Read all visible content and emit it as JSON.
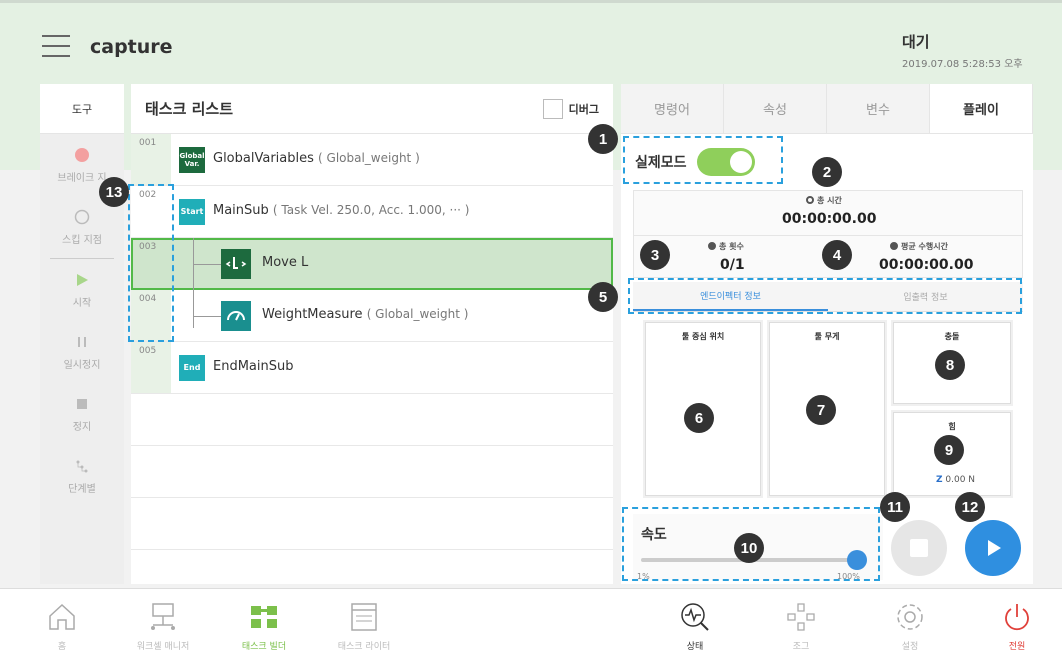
{
  "header": {
    "title": "capture",
    "status": "대기",
    "datetime": "2019.07.08 5:28:53 오후"
  },
  "tools": {
    "title": "도구",
    "items": [
      {
        "label": "브레이크 지",
        "icon": "breakpoint-icon"
      },
      {
        "label": "스킵 지점",
        "icon": "skip-point-icon"
      },
      {
        "label": "시작",
        "icon": "start-icon"
      },
      {
        "label": "일시정지",
        "icon": "pause-icon"
      },
      {
        "label": "정지",
        "icon": "stop-icon"
      },
      {
        "label": "단계별",
        "icon": "step-icon"
      }
    ]
  },
  "tasklist": {
    "title": "태스크 리스트",
    "debug_label": "디버그",
    "rows": [
      {
        "num": "001",
        "badge": "Global Var.",
        "name": "GlobalVariables",
        "param": "( Global_weight )"
      },
      {
        "num": "002",
        "badge": "Start",
        "name": "MainSub",
        "param": "( Task Vel. 250.0, Acc. 1.000, ··· )"
      },
      {
        "num": "003",
        "badge": "",
        "name": "Move L",
        "param": ""
      },
      {
        "num": "004",
        "badge": "",
        "name": "WeightMeasure",
        "param": "( Global_weight )"
      },
      {
        "num": "005",
        "badge": "End",
        "name": "EndMainSub",
        "param": ""
      }
    ]
  },
  "right": {
    "tabs": [
      "명령어",
      "속성",
      "변수",
      "플레이"
    ],
    "real_mode_label": "실제모드",
    "total_time_label": "총 시간",
    "total_time": "00:00:00.00",
    "total_count_label": "총 횟수",
    "total_count": "0/1",
    "avg_time_label": "평균 수행시간",
    "avg_time": "00:00:00.00",
    "subtabs": [
      "엔드이펙터 정보",
      "입출력 정보"
    ],
    "cards": {
      "tool_center": "툴 중심 위치",
      "tool_weight": "툴 무게",
      "collision": "충돌",
      "force": "힘",
      "force_axis": "Z",
      "force_value": "0.00 N"
    },
    "speed_label": "속도",
    "speed_min": "1%",
    "speed_max": "100%",
    "speed_value": 100
  },
  "bottom_nav": [
    {
      "label": "홈",
      "icon": "home-icon"
    },
    {
      "label": "워크셀 매니저",
      "icon": "workcell-icon"
    },
    {
      "label": "태스크 빌더",
      "icon": "task-builder-icon"
    },
    {
      "label": "태스크 라이터",
      "icon": "task-writer-icon"
    },
    {
      "label": "상태",
      "icon": "status-icon"
    },
    {
      "label": "조그",
      "icon": "jog-icon"
    },
    {
      "label": "설정",
      "icon": "settings-icon"
    },
    {
      "label": "전원",
      "icon": "power-icon"
    }
  ],
  "markers": [
    "1",
    "2",
    "3",
    "4",
    "5",
    "6",
    "7",
    "8",
    "9",
    "10",
    "11",
    "12",
    "13"
  ]
}
